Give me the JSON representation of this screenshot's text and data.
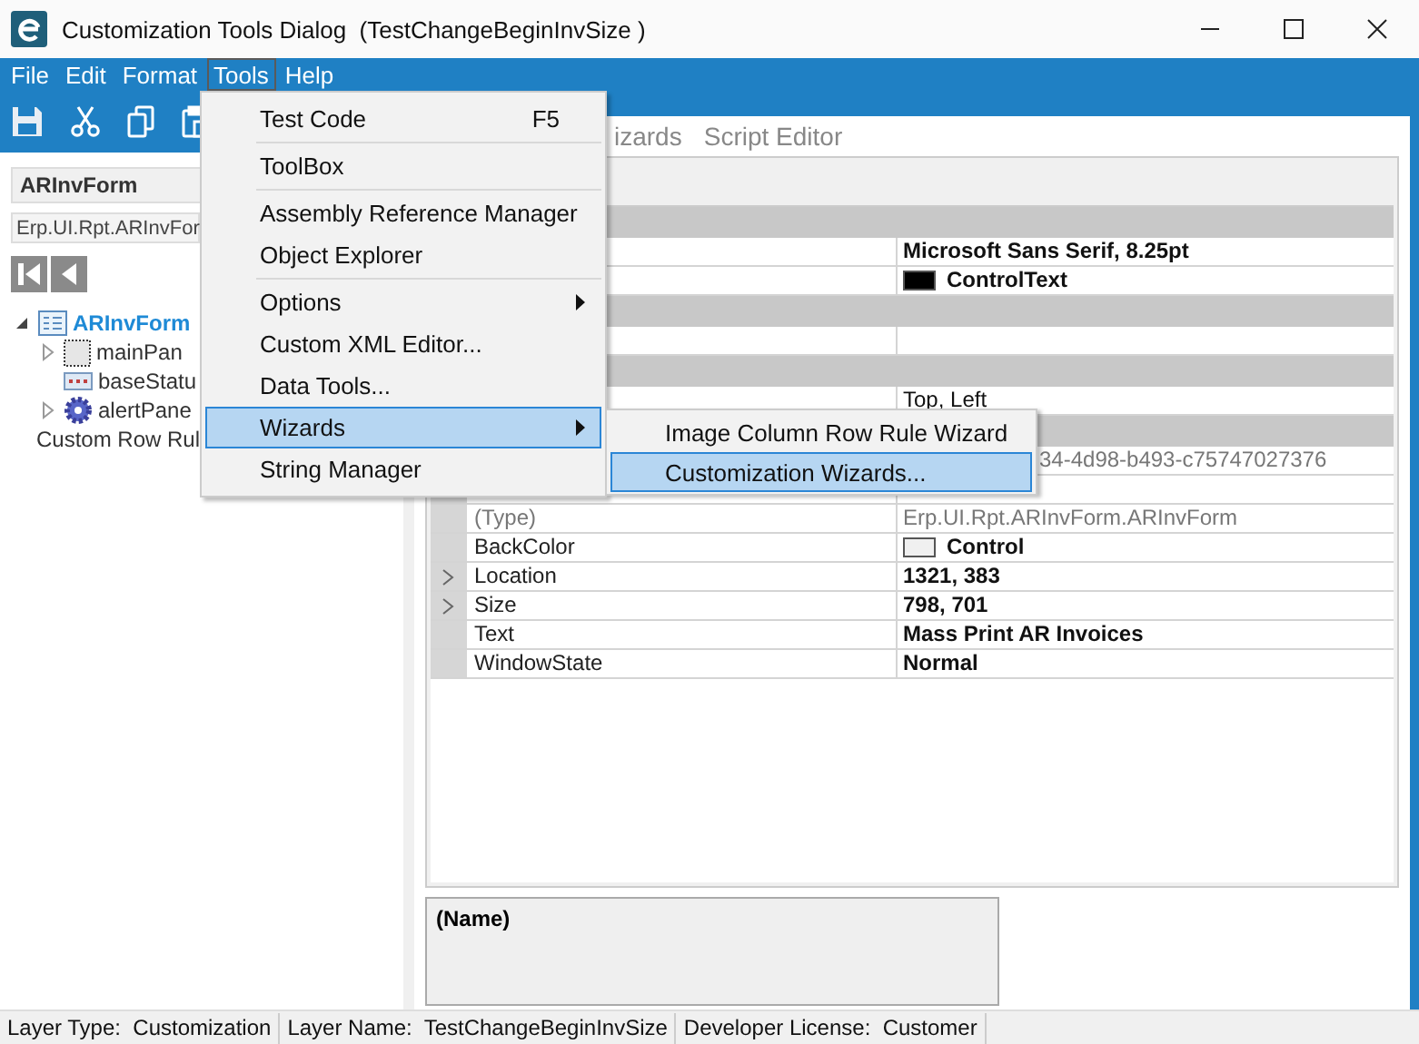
{
  "window": {
    "title": "Customization Tools Dialog  (TestChangeBeginInvSize )"
  },
  "menu_bar": [
    {
      "label": "File",
      "selected": false
    },
    {
      "label": "Edit",
      "selected": false
    },
    {
      "label": "Format",
      "selected": false
    },
    {
      "label": "Tools",
      "selected": true
    },
    {
      "label": "Help",
      "selected": false
    }
  ],
  "tools_menu": {
    "items": [
      {
        "kind": "item",
        "label": "Test Code",
        "shortcut": "F5",
        "has_submenu": false,
        "selected": false
      },
      {
        "kind": "separator"
      },
      {
        "kind": "item",
        "label": "ToolBox",
        "has_submenu": false,
        "selected": false
      },
      {
        "kind": "separator"
      },
      {
        "kind": "item",
        "label": "Assembly Reference Manager",
        "has_submenu": false,
        "selected": false
      },
      {
        "kind": "item",
        "label": "Object Explorer",
        "has_submenu": false,
        "selected": false
      },
      {
        "kind": "separator"
      },
      {
        "kind": "item",
        "label": "Options",
        "has_submenu": true,
        "selected": false
      },
      {
        "kind": "item",
        "label": "Custom XML Editor...",
        "has_submenu": false,
        "selected": false
      },
      {
        "kind": "item",
        "label": "Data Tools...",
        "has_submenu": false,
        "selected": false
      },
      {
        "kind": "item",
        "label": "Wizards",
        "has_submenu": true,
        "selected": true
      },
      {
        "kind": "item",
        "label": "String Manager",
        "has_submenu": false,
        "selected": false
      }
    ]
  },
  "wizards_submenu": {
    "items": [
      {
        "label": "Image Column Row Rule Wizard",
        "selected": false
      },
      {
        "label": "Customization Wizards...",
        "selected": true
      }
    ]
  },
  "left_panel": {
    "form_name": "ARInvForm",
    "form_class": "Erp.UI.Rpt.ARInvFor",
    "tree": [
      {
        "kind": "form",
        "label": "ARInvForm",
        "expanded": true,
        "selected": true,
        "children": [
          {
            "kind": "panel",
            "label": "mainPan",
            "expanded": false,
            "selected": false
          },
          {
            "kind": "status",
            "label": "baseStatu",
            "selected": false
          },
          {
            "kind": "gear",
            "label": "alertPane",
            "expanded": false,
            "selected": false
          }
        ]
      },
      {
        "kind": "plain",
        "label": "Custom Row Rul",
        "selected": false
      }
    ]
  },
  "tabs": [
    {
      "label": "izards",
      "selected": false
    },
    {
      "label": "Script Editor",
      "selected": false
    }
  ],
  "property_grid": {
    "rows": [
      {
        "kind": "category"
      },
      {
        "kind": "property",
        "value": "Microsoft Sans Serif, 8.25pt",
        "bold": true
      },
      {
        "kind": "property",
        "value": "ControlText",
        "bold": true,
        "color": "#000000"
      },
      {
        "kind": "category"
      },
      {
        "kind": "property"
      },
      {
        "kind": "category"
      },
      {
        "kind": "property",
        "value": "Top, Left"
      },
      {
        "kind": "category"
      },
      {
        "kind": "property",
        "value": "34-4d98-b493-c75747027376",
        "readonly": true,
        "clipped": true
      },
      {
        "kind": "property"
      },
      {
        "kind": "property",
        "name": "(Type)",
        "value": "Erp.UI.Rpt.ARInvForm.ARInvForm",
        "readonly": true
      },
      {
        "kind": "property",
        "name": "BackColor",
        "value": "Control",
        "bold": true,
        "color": "#f0f0f0"
      },
      {
        "kind": "property",
        "name": "Location",
        "value": "1321, 383",
        "bold": true,
        "expandable": true
      },
      {
        "kind": "property",
        "name": "Size",
        "value": "798, 701",
        "bold": true,
        "expandable": true
      },
      {
        "kind": "property",
        "name": "Text",
        "value": "Mass Print AR Invoices",
        "bold": true
      },
      {
        "kind": "property",
        "name": "WindowState",
        "value": "Normal",
        "bold": true
      }
    ],
    "description": "(Name)"
  },
  "status_bar": [
    "Layer Type:  Customization",
    "Layer Name:  TestChangeBeginInvSize",
    "Developer License:  Customer"
  ]
}
